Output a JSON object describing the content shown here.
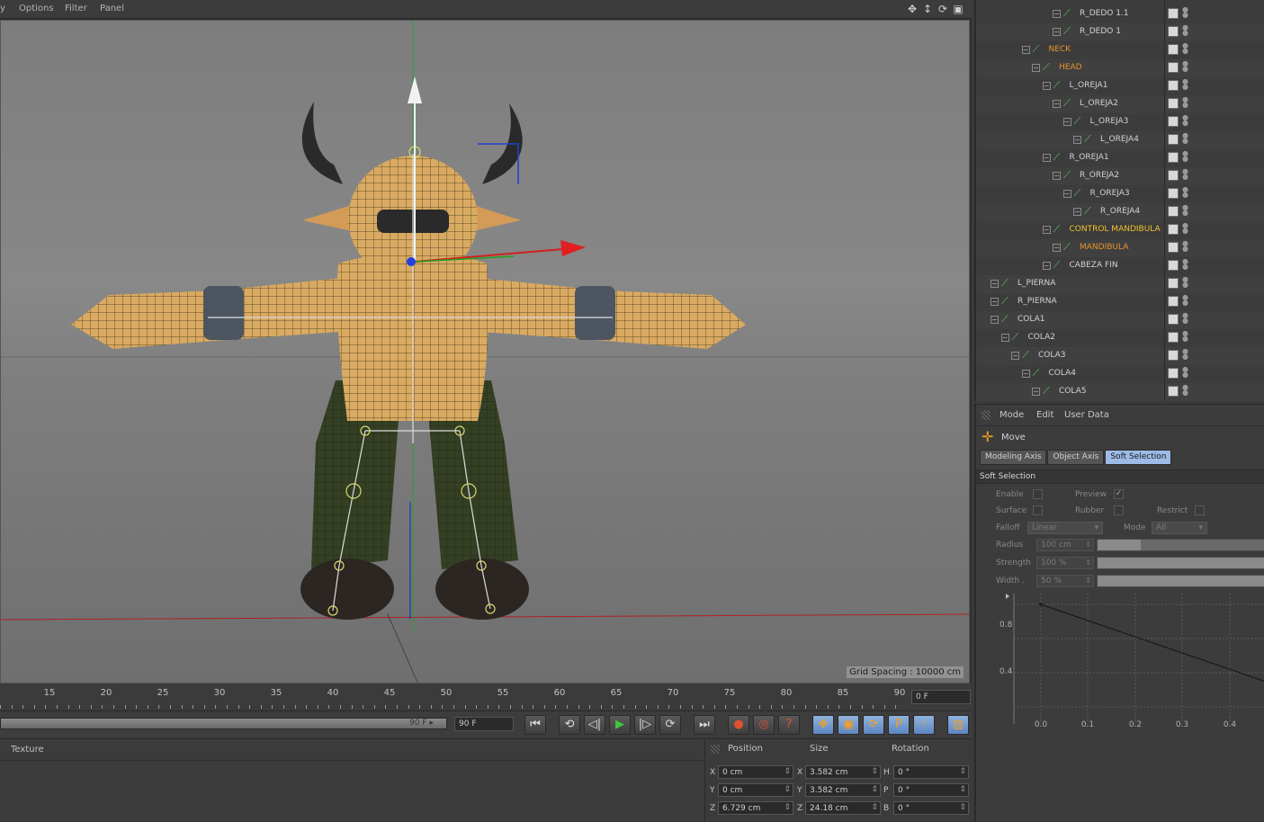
{
  "viewport": {
    "menu": [
      "y",
      "Options",
      "Filter",
      "Panel"
    ],
    "nav_icons": [
      "move-view-icon",
      "dolly-view-icon",
      "rotate-view-icon",
      "maximize-view-icon"
    ],
    "grid_spacing": "Grid Spacing : 10000 cm"
  },
  "timeline": {
    "ticks": [
      "15",
      "20",
      "25",
      "30",
      "35",
      "40",
      "45",
      "50",
      "55",
      "60",
      "65",
      "70",
      "75",
      "80",
      "85",
      "90"
    ],
    "current_frame": "0 F",
    "range_end_label": "90 F",
    "end_frame": "90 F"
  },
  "transport": {
    "buttons": [
      "⏮",
      "⟲",
      "◁|",
      "▶",
      "|▷",
      "⟳",
      "⏭"
    ],
    "key_buttons": [
      "●",
      "◎",
      "?"
    ],
    "mode_buttons": [
      "✥",
      "▣",
      "⟳",
      "P",
      "⁘",
      "▥"
    ]
  },
  "material_panel": {
    "texture_label": "Texture"
  },
  "coords": {
    "headers": {
      "position": "Position",
      "size": "Size",
      "rotation": "Rotation"
    },
    "rows": [
      {
        "axis": "X",
        "pos": "0 cm",
        "size_axis": "X",
        "size": "3.582 cm",
        "rot_axis": "H",
        "rot": "0 °"
      },
      {
        "axis": "Y",
        "pos": "0 cm",
        "size_axis": "Y",
        "size": "3.582 cm",
        "rot_axis": "P",
        "rot": "0 °"
      },
      {
        "axis": "Z",
        "pos": "6.729 cm",
        "size_axis": "Z",
        "size": "24.18 cm",
        "rot_axis": "B",
        "rot": "0 °"
      }
    ]
  },
  "object_manager": {
    "rows": [
      {
        "label": "R_DEDO 1.1",
        "indent": 6,
        "color": "white"
      },
      {
        "label": "R_DEDO 1",
        "indent": 6,
        "color": "white"
      },
      {
        "label": "NECK",
        "indent": 3,
        "color": "orange"
      },
      {
        "label": "HEAD",
        "indent": 4,
        "color": "orange"
      },
      {
        "label": "L_OREJA1",
        "indent": 5,
        "color": "white"
      },
      {
        "label": "L_OREJA2",
        "indent": 6,
        "color": "white"
      },
      {
        "label": "L_OREJA3",
        "indent": 7,
        "color": "white"
      },
      {
        "label": "L_OREJA4",
        "indent": 8,
        "color": "white"
      },
      {
        "label": "R_OREJA1",
        "indent": 5,
        "color": "white"
      },
      {
        "label": "R_OREJA2",
        "indent": 6,
        "color": "white"
      },
      {
        "label": "R_OREJA3",
        "indent": 7,
        "color": "white"
      },
      {
        "label": "R_OREJA4",
        "indent": 8,
        "color": "white"
      },
      {
        "label": "CONTROL MANDIBULA",
        "indent": 5,
        "color": "yellow"
      },
      {
        "label": "MANDIBULA",
        "indent": 6,
        "color": "orange"
      },
      {
        "label": "CABEZA FIN",
        "indent": 5,
        "color": "white"
      },
      {
        "label": "L_PIERNA",
        "indent": 0,
        "color": "white"
      },
      {
        "label": "R_PIERNA",
        "indent": 0,
        "color": "white"
      },
      {
        "label": "COLA1",
        "indent": 0,
        "color": "white"
      },
      {
        "label": "COLA2",
        "indent": 1,
        "color": "white"
      },
      {
        "label": "COLA3",
        "indent": 2,
        "color": "white"
      },
      {
        "label": "COLA4",
        "indent": 3,
        "color": "white"
      },
      {
        "label": "COLA5",
        "indent": 4,
        "color": "white"
      }
    ]
  },
  "attributes": {
    "menu": {
      "mode": "Mode",
      "edit": "Edit",
      "user_data": "User Data"
    },
    "tool_name": "Move",
    "tabs": [
      "Modeling Axis",
      "Object Axis",
      "Soft Selection"
    ],
    "active_tab": "Soft Selection",
    "section": "Soft Selection",
    "enable_label": "Enable",
    "preview_label": "Preview",
    "preview_check": "✓",
    "surface_label": "Surface",
    "rubber_label": "Rubber",
    "restrict_label": "Restrict",
    "falloff_label": "Falloff",
    "falloff_value": "Linear",
    "mode_label": "Mode",
    "mode_value": "All",
    "radius_label": "Radius",
    "radius_value": "100 cm",
    "strength_label": "Strength",
    "strength_value": "100 %",
    "width_label": "Width",
    "width_dot": ".",
    "width_value": "50 %",
    "graph": {
      "y_ticks": [
        "0.8",
        "0.4"
      ],
      "x_ticks": [
        "0.0",
        "0.1",
        "0.2",
        "0.3",
        "0.4"
      ]
    }
  }
}
